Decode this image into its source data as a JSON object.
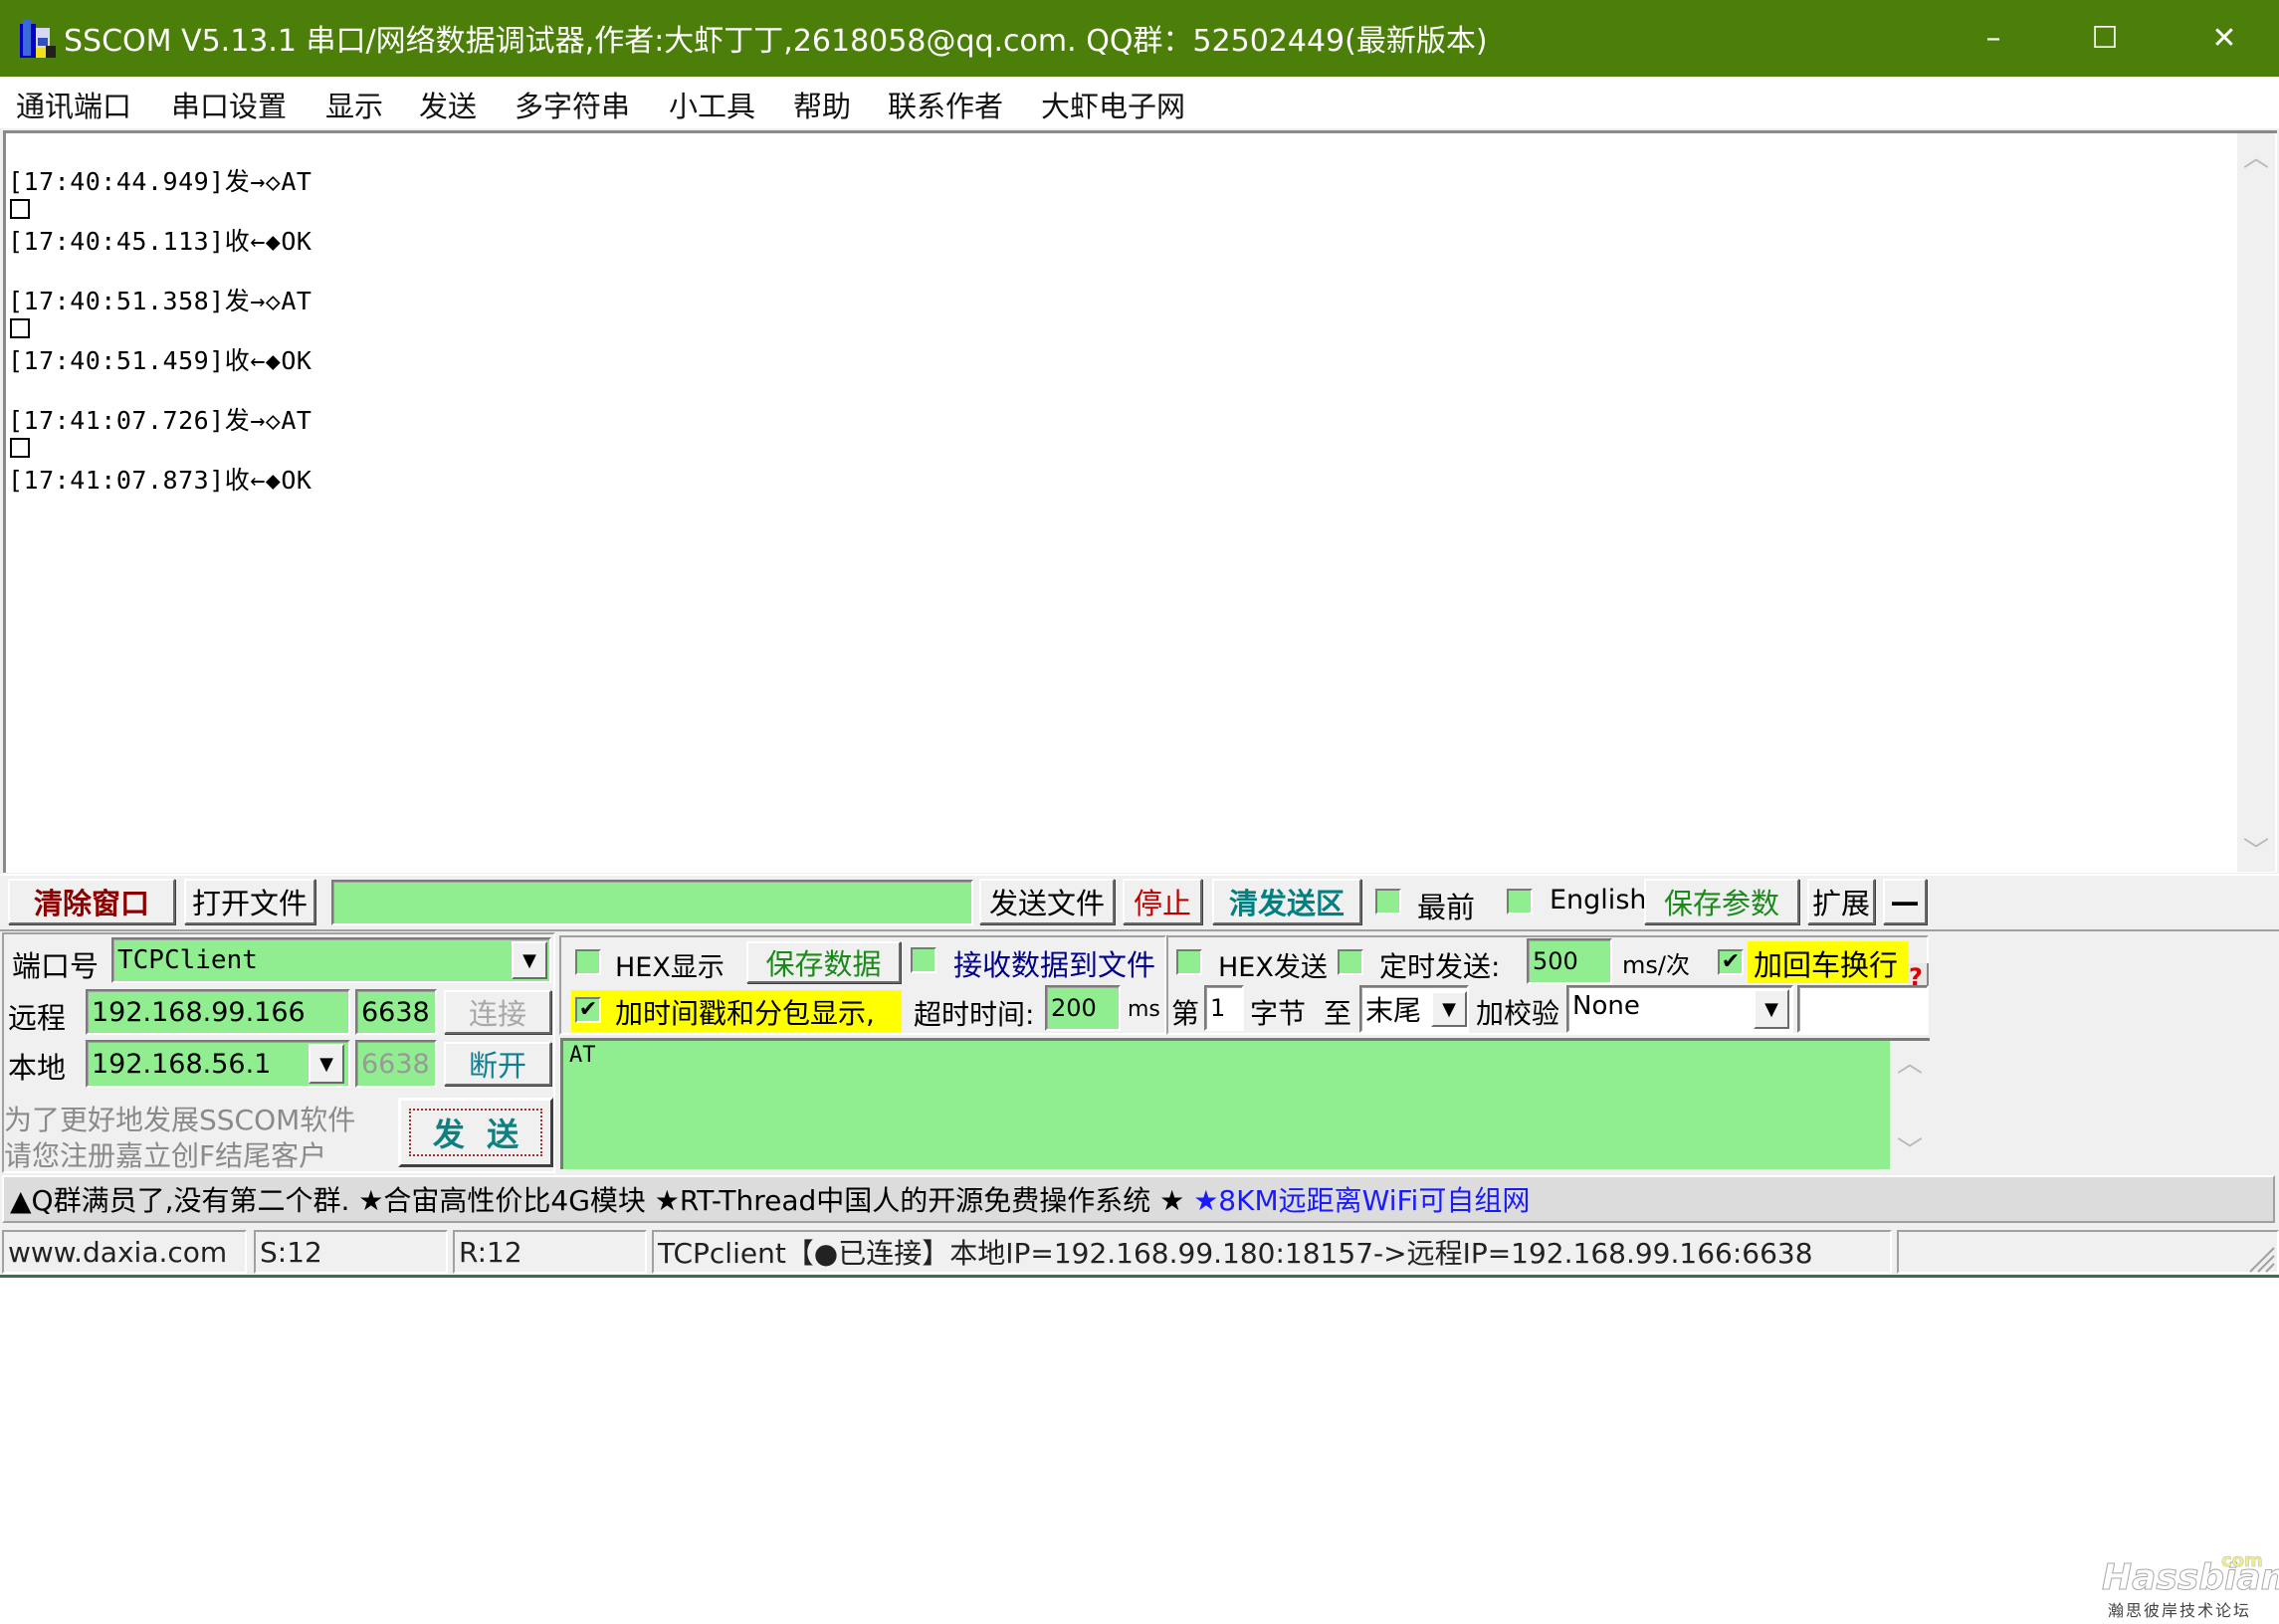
{
  "window": {
    "title": "SSCOM V5.13.1 串口/网络数据调试器,作者:大虾丁丁,2618058@qq.com. QQ群：52502449(最新版本)",
    "title_bar_color": "#4b7f0a",
    "controls": {
      "minimize": "–",
      "maximize": "☐",
      "close": "✕"
    }
  },
  "menu": [
    "通讯端口",
    "串口设置",
    "显示",
    "发送",
    "多字符串",
    "小工具",
    "帮助",
    "联系作者",
    "大虾电子网"
  ],
  "log": {
    "entries": [
      {
        "time": "[17:40:44.949]",
        "dir": "发→◇",
        "data": "AT"
      },
      {
        "time": "[17:40:45.113]",
        "dir": "收←◆",
        "data": "OK"
      },
      {
        "time": "[17:40:51.358]",
        "dir": "发→◇",
        "data": "AT"
      },
      {
        "time": "[17:40:51.459]",
        "dir": "收←◆",
        "data": "OK"
      },
      {
        "time": "[17:41:07.726]",
        "dir": "发→◇",
        "data": "AT"
      },
      {
        "time": "[17:41:07.873]",
        "dir": "收←◆",
        "data": "OK"
      }
    ],
    "lines": [
      "[17:40:44.949]发→◇AT",
      "[17:40:45.113]收←◆OK",
      "[17:40:51.358]发→◇AT",
      "[17:40:51.459]收←◆OK",
      "[17:41:07.726]发→◇AT",
      "[17:41:07.873]收←◆OK"
    ]
  },
  "toolbar": {
    "clear_window": "清除窗口",
    "open_file": "打开文件",
    "file_path": "",
    "send_file": "发送文件",
    "stop": "停止",
    "clear_send": "清发送区",
    "topmost_label": "最前",
    "topmost_checked": false,
    "english_label": "English",
    "english_checked": false,
    "save_params": "保存参数",
    "expand": "扩展",
    "collapse": "—"
  },
  "connection": {
    "port_label": "端口号",
    "port_value": "TCPClient",
    "remote_label": "远程",
    "remote_ip": "192.168.99.166",
    "remote_port": "6638",
    "connect_button": "连接",
    "local_label": "本地",
    "local_ip": "192.168.56.1",
    "local_port": "6638",
    "disconnect_button": "断开",
    "ad_line1": "为了更好地发展SSCOM软件",
    "ad_line2": "请您注册嘉立创F结尾客户",
    "send_button": "发  送"
  },
  "receive_options": {
    "hex_display_label": "HEX显示",
    "hex_display_checked": false,
    "save_data": "保存数据",
    "receive_to_file_label": "接收数据到文件",
    "receive_to_file_checked": false,
    "timestamp_label": "加时间戳和分包显示,",
    "timestamp_checked": true,
    "timeout_label": "超时时间:",
    "timeout_value": "200",
    "timeout_unit": "ms"
  },
  "send_options": {
    "hex_send_label": "HEX发送",
    "hex_send_checked": false,
    "timed_send_label": "定时发送:",
    "timed_send_checked": false,
    "interval_value": "500",
    "interval_unit": "ms/次",
    "crlf_label": "加回车换行",
    "crlf_checked": true,
    "help": "?",
    "byte_from_label": "第",
    "byte_from_value": "1",
    "byte_label": "字节",
    "to_label": "至",
    "to_value": "末尾",
    "checksum_label": "加校验",
    "checksum_value": "None",
    "extra_value": ""
  },
  "send_text": "AT",
  "marquee": {
    "text_black": "▲Q群满员了,没有第二个群. ★合宙高性价比4G模块 ★RT-Thread中国人的开源免费操作系统 ★ ",
    "text_blue": "★8KM远距离WiFi可自组网"
  },
  "status_bar": {
    "website": "www.daxia.com",
    "sent": "S:12",
    "received": "R:12",
    "connection_info": "TCPclient【●已连接】本地IP=192.168.99.180:18157->远程IP=192.168.99.166:6638",
    "extra": ""
  },
  "watermark": {
    "brand": "Hassbian",
    "suffix": "com",
    "subtitle": "瀚思彼岸技术论坛"
  }
}
